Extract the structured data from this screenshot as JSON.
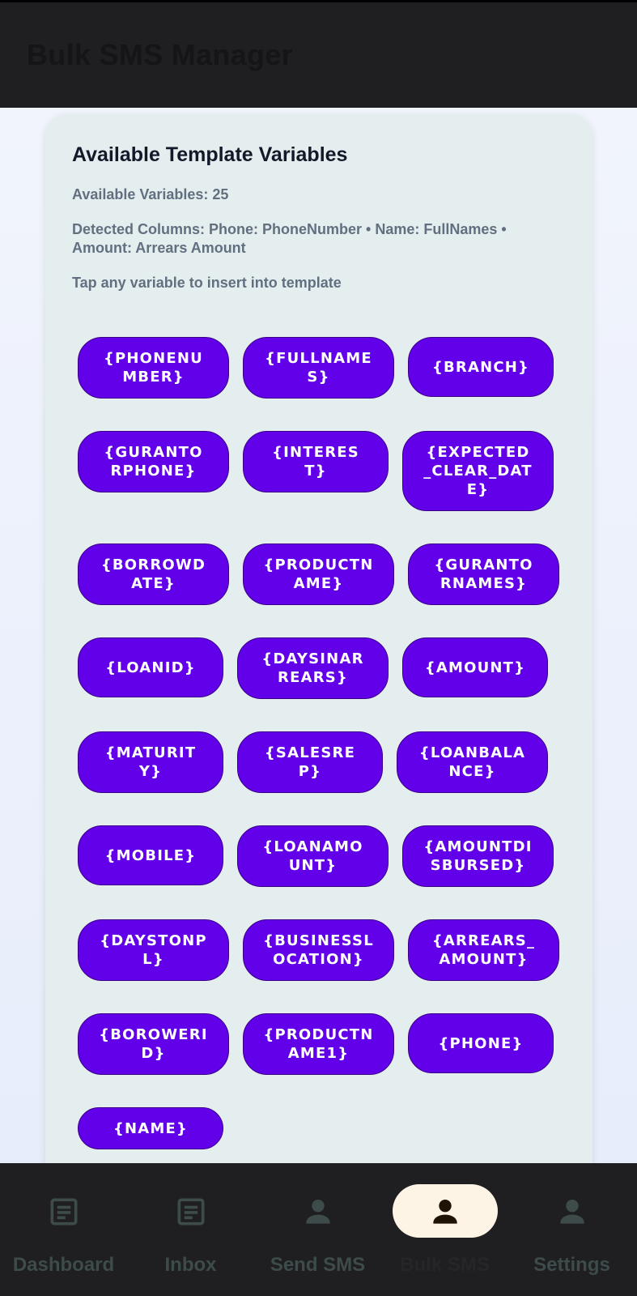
{
  "app_bar": {
    "title": "Bulk SMS Manager"
  },
  "card": {
    "title": "Available Template Variables",
    "count_text": "Available Variables: 25",
    "detected_columns": "Detected Columns: Phone: PhoneNumber • Name: FullNames • Amount: Arrears Amount",
    "hint": "Tap any variable to insert into template"
  },
  "variables": [
    "{PHONENUMBER}",
    "{FULLNAMES}",
    "{BRANCH}",
    "{GURANTORPHONE}",
    "{INTEREST}",
    "{EXPECTED_CLEAR_DATE}",
    "{BORROWDATE}",
    "{PRODUCTNAME}",
    "{GURANTORNAMES}",
    "{LOANID}",
    "{DAYSINARREARS}",
    "{AMOUNT}",
    "{MATURITY}",
    "{SALESREP}",
    "{LOANBALANCE}",
    "{MOBILE}",
    "{LOANAMOUNT}",
    "{AMOUNTDISBURSED}",
    "{DAYSTONPL}",
    "{BUSINESSLOCATION}",
    "{ARREARS_AMOUNT}",
    "{BOROWERID}",
    "{PRODUCTNAME1}",
    "{PHONE}",
    "{NAME}"
  ],
  "nav": {
    "items": [
      {
        "label": "Dashboard",
        "icon": "document-icon"
      },
      {
        "label": "Inbox",
        "icon": "document-icon"
      },
      {
        "label": "Send SMS",
        "icon": "person-icon"
      },
      {
        "label": "Bulk SMS",
        "icon": "person-icon",
        "active": true
      },
      {
        "label": "Settings",
        "icon": "person-icon"
      }
    ]
  },
  "colors": {
    "chip": "#6200ea",
    "bar": "#1f1f22",
    "card": "#e5eeee",
    "active_indicator": "#fdf4e6",
    "nav_icon": "#3d4b4a"
  }
}
